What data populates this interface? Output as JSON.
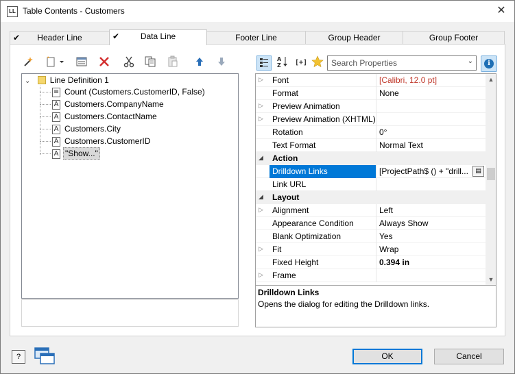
{
  "window": {
    "app_icon_text": "LL",
    "title": "Table Contents - Customers",
    "close_glyph": "✕"
  },
  "tabs": [
    {
      "label": "Header Line",
      "checked": true,
      "active": false
    },
    {
      "label": "Data Line",
      "checked": true,
      "active": true
    },
    {
      "label": "Footer Line",
      "checked": false,
      "active": false
    },
    {
      "label": "Group Header",
      "checked": false,
      "active": false
    },
    {
      "label": "Group Footer",
      "checked": false,
      "active": false
    }
  ],
  "left_toolbar": {
    "icons": [
      "wand-icon",
      "insert-icon",
      "properties-icon",
      "delete-icon",
      "cut-icon",
      "copy-icon",
      "paste-icon",
      "move-up-icon",
      "move-down-icon"
    ]
  },
  "tree": {
    "root": {
      "label": "Line Definition  1",
      "expanded": true
    },
    "items": [
      {
        "label": "Count (Customers.CustomerID, False)",
        "icon": "formula-icon"
      },
      {
        "label": "Customers.CompanyName",
        "icon": "text-field-icon"
      },
      {
        "label": "Customers.ContactName",
        "icon": "text-field-icon"
      },
      {
        "label": "Customers.City",
        "icon": "text-field-icon"
      },
      {
        "label": "Customers.CustomerID",
        "icon": "text-field-icon"
      },
      {
        "label": "\"Show...\"",
        "icon": "text-field-icon",
        "selected": true
      }
    ]
  },
  "right_toolbar": {
    "icons": [
      "categorized-icon",
      "sort-az-icon",
      "formula-mode-icon",
      "favorite-star-icon"
    ],
    "search_placeholder": "Search Properties",
    "info_glyph": "i"
  },
  "properties": [
    {
      "name": "Font",
      "value": "[Calibri, 12.0 pt]",
      "expandable": true,
      "style": "red"
    },
    {
      "name": "Format",
      "value": "None",
      "expandable": false
    },
    {
      "name": "Preview Animation",
      "value": "",
      "expandable": true
    },
    {
      "name": "Preview Animation (XHTML)",
      "value": "",
      "expandable": true
    },
    {
      "name": "Rotation",
      "value": "0°",
      "expandable": false
    },
    {
      "name": "Text Format",
      "value": "Normal Text",
      "expandable": false
    },
    {
      "name": "Action",
      "category": true
    },
    {
      "name": "Drilldown Links",
      "value": "[ProjectPath$ () + \"drill...",
      "expandable": false,
      "selected": true,
      "has_button": true
    },
    {
      "name": "Link URL",
      "value": "",
      "expandable": false
    },
    {
      "name": "Layout",
      "category": true
    },
    {
      "name": "Alignment",
      "value": "Left",
      "expandable": true
    },
    {
      "name": "Appearance Condition",
      "value": "Always Show",
      "expandable": false
    },
    {
      "name": "Blank Optimization",
      "value": "Yes",
      "expandable": false
    },
    {
      "name": "Fit",
      "value": "Wrap",
      "expandable": true
    },
    {
      "name": "Fixed Height",
      "value": "0.394 in",
      "expandable": false,
      "style": "bold"
    },
    {
      "name": "Frame",
      "value": "",
      "expandable": true
    }
  ],
  "description": {
    "title": "Drilldown Links",
    "text": "Opens the dialog for editing the Drilldown links."
  },
  "footer": {
    "help_glyph": "?",
    "ok_label": "OK",
    "cancel_label": "Cancel"
  },
  "colors": {
    "accent": "#0078d7",
    "selection": "#0078d7",
    "red_value": "#c0392b",
    "delete_red": "#d32f2f",
    "folder_yellow": "#f5d76e"
  }
}
